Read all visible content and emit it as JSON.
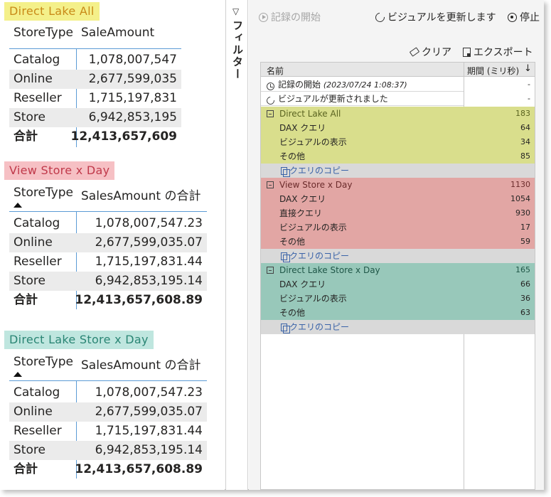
{
  "tables": [
    {
      "title": "Direct Lake All",
      "title_bg": "#f4f08a",
      "title_color": "#c98a18",
      "header": {
        "col1": "StoreType",
        "col2": "SaleAmount"
      },
      "sort_indicator": false,
      "rows": [
        {
          "key": "Catalog",
          "value": "1,078,007,547"
        },
        {
          "key": "Online",
          "value": "2,677,599,035"
        },
        {
          "key": "Reseller",
          "value": "1,715,197,831"
        },
        {
          "key": "Store",
          "value": "6,942,853,195"
        }
      ],
      "total": {
        "key": "合計",
        "value": "12,413,657,609"
      }
    },
    {
      "title": "View Store x Day",
      "title_bg": "#f6c0c4",
      "title_color": "#c0394a",
      "header": {
        "col1": "StoreType",
        "col2": "SalesAmount の合計"
      },
      "sort_indicator": true,
      "rows": [
        {
          "key": "Catalog",
          "value": "1,078,007,547.23"
        },
        {
          "key": "Online",
          "value": "2,677,599,035.07"
        },
        {
          "key": "Reseller",
          "value": "1,715,197,831.44"
        },
        {
          "key": "Store",
          "value": "6,942,853,195.14"
        }
      ],
      "total": {
        "key": "合計",
        "value": "12,413,657,608.89"
      }
    },
    {
      "title": "Direct Lake Store x Day",
      "title_bg": "#bfe6df",
      "title_color": "#2a8574",
      "header": {
        "col1": "StoreType",
        "col2": "SalesAmount の合計"
      },
      "sort_indicator": true,
      "rows": [
        {
          "key": "Catalog",
          "value": "1,078,007,547.23"
        },
        {
          "key": "Online",
          "value": "2,677,599,035.07"
        },
        {
          "key": "Reseller",
          "value": "1,715,197,831.44"
        },
        {
          "key": "Store",
          "value": "6,942,853,195.14"
        }
      ],
      "total": {
        "key": "合計",
        "value": "12,413,657,608.89"
      }
    }
  ],
  "filters": {
    "label": "フィルター"
  },
  "perf": {
    "start_recording": "記録の開始",
    "refresh_visuals": "ビジュアルを更新します",
    "stop": "停止",
    "clear": "クリア",
    "export": "エクスポート",
    "col_name": "名前",
    "col_duration": "期間 (ミリ秒)",
    "events": [
      {
        "label": "記録の開始",
        "detail": "(2023/07/24 1:08:37)",
        "value": "-"
      },
      {
        "label": "ビジュアルが更新されました",
        "detail": "",
        "value": "-"
      }
    ],
    "copy_query": "クエリのコピー",
    "groups": [
      {
        "name": "Direct Lake All",
        "value": "183",
        "color": "#d9de8c",
        "items": [
          {
            "label": "DAX クエリ",
            "value": "64"
          },
          {
            "label": "ビジュアルの表示",
            "value": "34"
          },
          {
            "label": "その他",
            "value": "85"
          }
        ]
      },
      {
        "name": "View Store x Day",
        "value": "1130",
        "color": "#e2a6a4",
        "items": [
          {
            "label": "DAX クエリ",
            "value": "1054"
          },
          {
            "label": "直接クエリ",
            "value": "930"
          },
          {
            "label": "ビジュアルの表示",
            "value": "17"
          },
          {
            "label": "その他",
            "value": "59"
          }
        ]
      },
      {
        "name": "Direct Lake Store x Day",
        "value": "165",
        "color": "#98c8ba",
        "items": [
          {
            "label": "DAX クエリ",
            "value": "66"
          },
          {
            "label": "ビジュアルの表示",
            "value": "36"
          },
          {
            "label": "その他",
            "value": "63"
          }
        ]
      }
    ]
  }
}
